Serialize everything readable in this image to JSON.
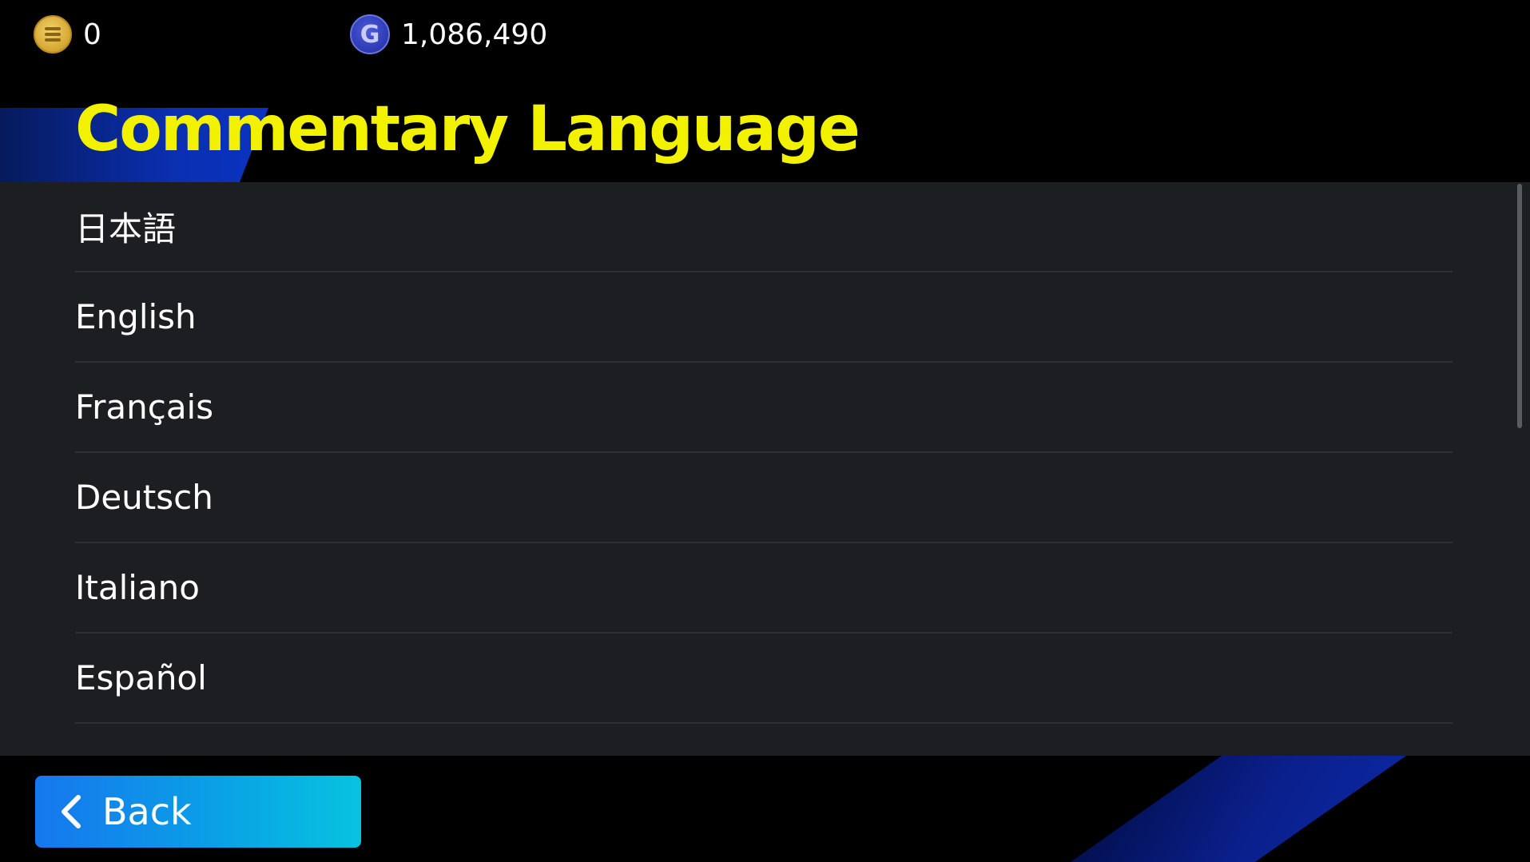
{
  "currency": {
    "coins": {
      "icon": "ecoin-icon",
      "value": "0",
      "color": "#d4a630"
    },
    "gp": {
      "icon": "gp-icon",
      "glyph": "G",
      "value": "1,086,490",
      "color": "#2a37b0"
    }
  },
  "page": {
    "title": "Commentary Language",
    "title_color": "#f2f200"
  },
  "languages": [
    {
      "label": "日本語"
    },
    {
      "label": "English"
    },
    {
      "label": "Français"
    },
    {
      "label": "Deutsch"
    },
    {
      "label": "Italiano"
    },
    {
      "label": "Español"
    }
  ],
  "footer": {
    "back_label": "Back",
    "back_icon": "chevron-left-icon"
  }
}
